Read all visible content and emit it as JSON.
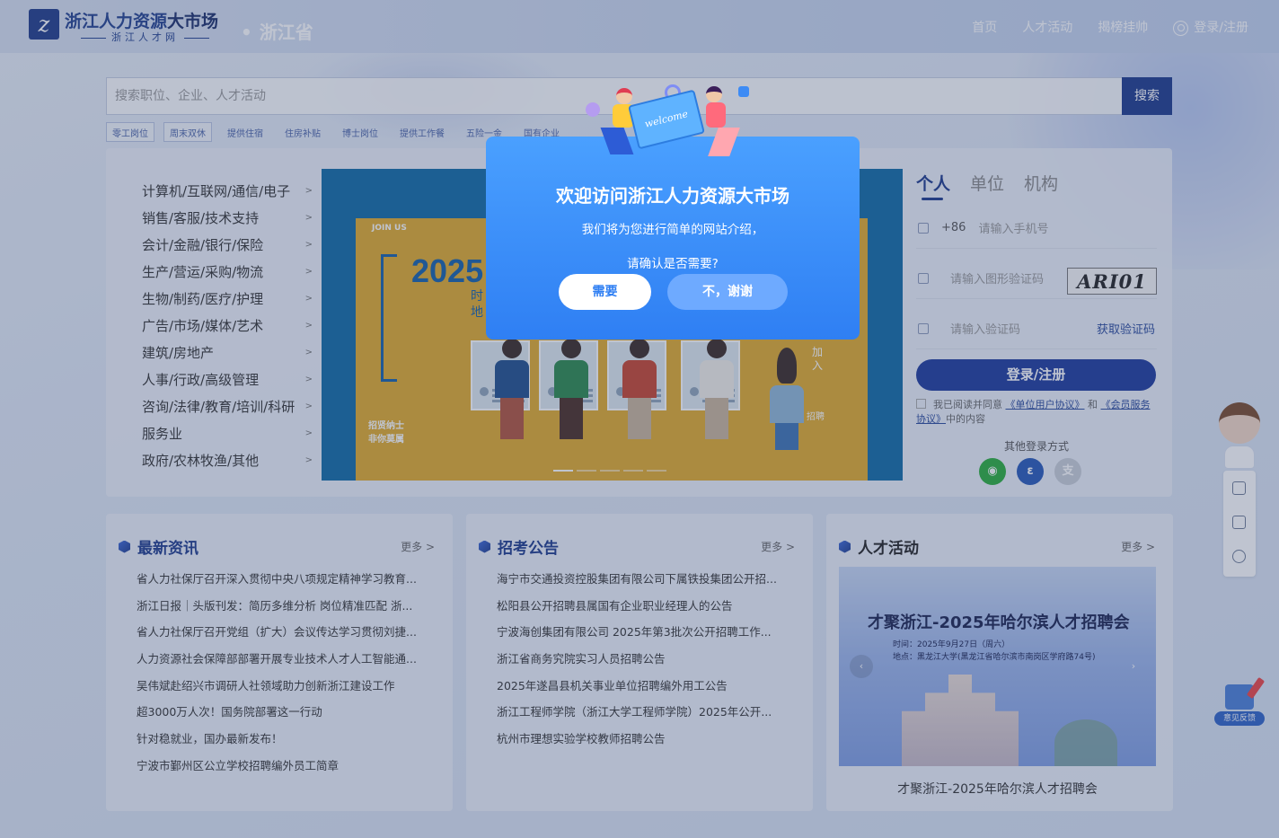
{
  "header": {
    "logo_mark": "z",
    "title_main": "浙江人力资源",
    "title_bold": "大市场",
    "subtitle": "浙江人才网",
    "region": "浙江省",
    "nav": [
      "首页",
      "人才活动",
      "揭榜挂帅"
    ],
    "login": "登录/注册"
  },
  "search": {
    "placeholder": "搜索职位、企业、人才活动",
    "button": "搜索",
    "tags": [
      "零工岗位",
      "周末双休",
      "提供住宿",
      "住房补贴",
      "博士岗位",
      "提供工作餐",
      "五险一金",
      "国有企业"
    ]
  },
  "categories": [
    "计算机/互联网/通信/电子",
    "销售/客服/技术支持",
    "会计/金融/银行/保险",
    "生产/营运/采购/物流",
    "生物/制药/医疗/护理",
    "广告/市场/媒体/艺术",
    "建筑/房地产",
    "人事/行政/高级管理",
    "咨询/法律/教育/培训/科研",
    "服务业",
    "政府/农林牧渔/其他"
  ],
  "banner": {
    "join": "JOIN US",
    "year": "2025",
    "time1": "时",
    "time2": "地",
    "recruit1": "招贤纳士",
    "recruit2": "非你莫属",
    "side": "加入",
    "side2": "招聘"
  },
  "login": {
    "tabs": [
      "个人",
      "单位",
      "机构"
    ],
    "phone_prefix": "+86",
    "phone_placeholder": "请输入手机号",
    "captcha_placeholder": "请输入图形验证码",
    "captcha_text": "ARI01",
    "code_placeholder": "请输入验证码",
    "get_code": "获取验证码",
    "submit": "登录/注册",
    "agree_prefix": "我已阅读并同意",
    "agree_link1": "《单位用户协议》",
    "agree_and": "和",
    "agree_link2": "《会员服务协议》",
    "agree_suffix": "中的内容",
    "other_login": "其他登录方式"
  },
  "news": {
    "title": "最新资讯",
    "more": "更多 >",
    "items": [
      "省人力社保厅召开深入贯彻中央八项规定精神学习教育...",
      "浙江日报｜头版刊发：简历多维分析 岗位精准匹配 浙...",
      "省人力社保厅召开党组（扩大）会议传达学习贯彻刘捷...",
      "人力资源社会保障部部署开展专业技术人才人工智能通...",
      "吴伟斌赴绍兴市调研人社领域助力创新浙江建设工作",
      "超3000万人次！国务院部署这一行动",
      "针对稳就业，国办最新发布！",
      "宁波市鄞州区公立学校招聘编外员工简章"
    ]
  },
  "exam": {
    "title": "招考公告",
    "more": "更多 >",
    "items": [
      "海宁市交通投资控股集团有限公司下属铁投集团公开招...",
      "松阳县公开招聘县属国有企业职业经理人的公告",
      "宁波海创集团有限公司 2025年第3批次公开招聘工作...",
      "浙江省商务究院实习人员招聘公告",
      "2025年遂昌县机关事业单位招聘编外用工公告",
      "浙江工程师学院（浙江大学工程师学院）2025年公开...",
      "杭州市理想实验学校教师招聘公告"
    ]
  },
  "events": {
    "title": "人才活动",
    "more": "更多 >",
    "poster_title": "才聚浙江-2025年哈尔滨人才招聘会",
    "poster_time": "时间：2025年9月27日（周六）",
    "poster_place": "地点：黑龙江大学(黑龙江省哈尔滨市南岗区学府路74号)",
    "caption": "才聚浙江-2025年哈尔滨人才招聘会"
  },
  "feedback": "意见反馈",
  "modal": {
    "title": "欢迎访问浙江人力资源大市场",
    "text1": "我们将为您进行简单的网站介绍，",
    "text2": "请确认是否需要?",
    "yes": "需要",
    "no": "不，谢谢",
    "card_text": "welcome"
  },
  "colors": {
    "brand": "#1d3a8c",
    "modal": "#2f7ff3",
    "banner_bg": "#e2ab2c"
  }
}
